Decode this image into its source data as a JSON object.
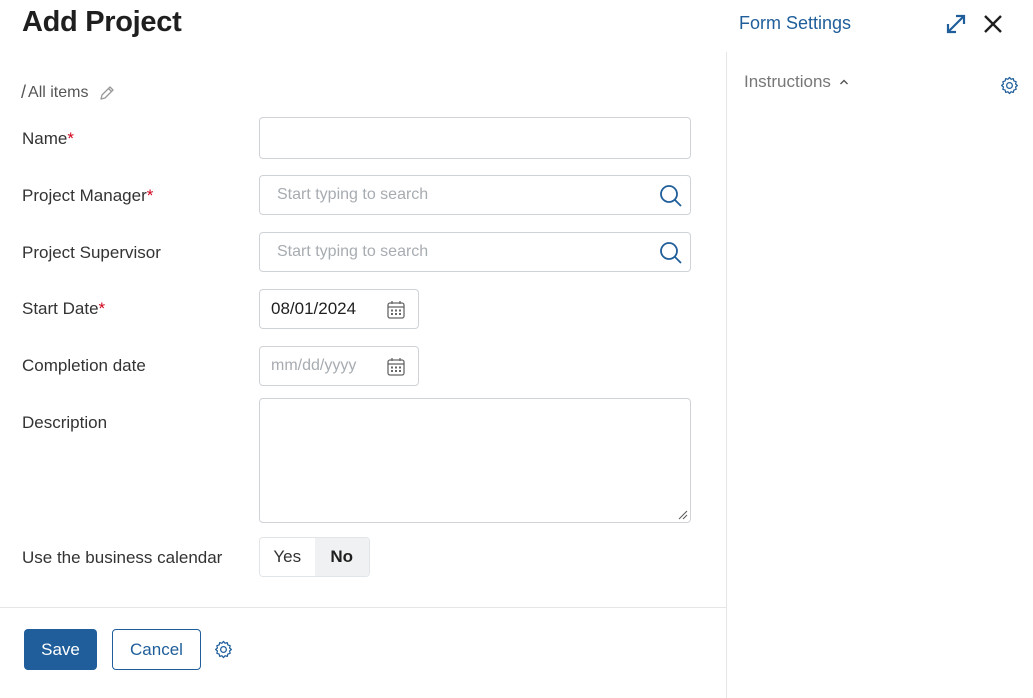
{
  "header": {
    "title": "Add Project",
    "form_settings": "Form Settings"
  },
  "breadcrumb": {
    "slash": "/",
    "text": "All items"
  },
  "fields": {
    "name": {
      "label": "Name",
      "required_mark": "*",
      "value": ""
    },
    "project_manager": {
      "label": "Project Manager",
      "required_mark": "*",
      "placeholder": "Start typing to search"
    },
    "project_supervisor": {
      "label": "Project Supervisor",
      "placeholder": "Start typing to search"
    },
    "start_date": {
      "label": "Start Date",
      "required_mark": "*",
      "value": "08/01/2024"
    },
    "completion_date": {
      "label": "Completion date",
      "placeholder": "mm/dd/yyyy"
    },
    "description": {
      "label": "Description",
      "value": ""
    },
    "business_calendar": {
      "label": "Use the business calendar",
      "yes": "Yes",
      "no": "No",
      "selected": "No"
    }
  },
  "footer": {
    "save": "Save",
    "cancel": "Cancel"
  },
  "side_panel": {
    "instructions": "Instructions"
  },
  "colors": {
    "accent": "#1f5e9a",
    "required": "#d0021b",
    "border": "#cfd3d8"
  },
  "icons": [
    "expand-icon",
    "close-icon",
    "pencil-icon",
    "search-icon",
    "calendar-icon",
    "gear-icon",
    "chevron-up-icon",
    "resize-handle-icon"
  ]
}
